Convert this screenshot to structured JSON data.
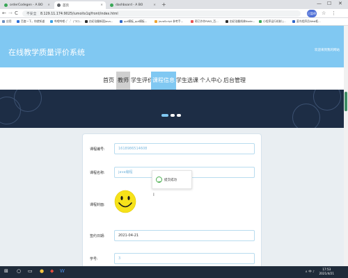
{
  "browser": {
    "tabs": [
      {
        "label": "orderCodegen - A BO",
        "x": "t0",
        "fav": "#3aa757",
        "active": false
      },
      {
        "label": "首页",
        "x": "t1",
        "fav": "#5f6368",
        "active": true
      },
      {
        "label": "dashboard - A BO",
        "x": "t2",
        "fav": "#3aa757",
        "active": false
      }
    ],
    "tab_close": "×",
    "new_tab": "+",
    "window_controls": {
      "minimize": "—",
      "maximize": "☐",
      "close": "✕"
    },
    "nav": {
      "back": "←",
      "forward": "→",
      "reload": "C"
    },
    "security_label": "不安全",
    "url": "8.129.11.174:9025/iumoitx1q/front/index.html",
    "profile_label": "已暂停"
  },
  "bookmarks": [
    {
      "label": "应用",
      "color": "#6c8ebf"
    },
    {
      "label": "百度一下，你就知道",
      "color": "#2f6fd6"
    },
    {
      "label": "哔哩哔哩 (゜-゜)つロ...",
      "color": "#39a0e6"
    },
    {
      "label": "由初治翻新国Java...",
      "color": "#2e2e2e"
    },
    {
      "label": "ppt模板_ppt模板...",
      "color": "#2e66c9"
    },
    {
      "label": "JavaScript 参考手...",
      "color": "#f0a531"
    },
    {
      "label": "帮已作作RWD_百...",
      "color": "#e95353"
    },
    {
      "label": "由初治翻线弗Node...",
      "color": "#2e2e2e"
    },
    {
      "label": "小程序运行机制 |...",
      "color": "#3aa757"
    },
    {
      "label": "菜鸟程序员Web框...",
      "color": "#2e66c9"
    }
  ],
  "site": {
    "title": "在线教学质量评价系统",
    "welcome": "欢迎来到我的网站",
    "nav": [
      "首页",
      "教师",
      "学生评价",
      "课程信息",
      "学生选课",
      "个人中心",
      "后台管理"
    ],
    "nav_active_index": 3,
    "nav_hover_index": 1
  },
  "form": {
    "course_no_label": "课程编号:",
    "course_no_value": "1618986514608",
    "course_name_label": "课程名称:",
    "course_name_value": "java编程",
    "cover_label": "课程封面:",
    "date_label": "签约日期:",
    "date_value": "2021-04-21",
    "credit_label": "学号:",
    "credit_value": "3"
  },
  "toast": {
    "message": "提交成功"
  },
  "taskbar": {
    "icons": [
      "⊞",
      "○",
      "▭",
      "●",
      "◆",
      "W"
    ],
    "tray": "∧ 中 ♪",
    "time": "17:53",
    "date": "2021/4/21"
  },
  "colors": {
    "accent": "#80c8f2",
    "banner": "#1d2d45",
    "input_border": "#b8dcef",
    "success": "#4caf50"
  }
}
